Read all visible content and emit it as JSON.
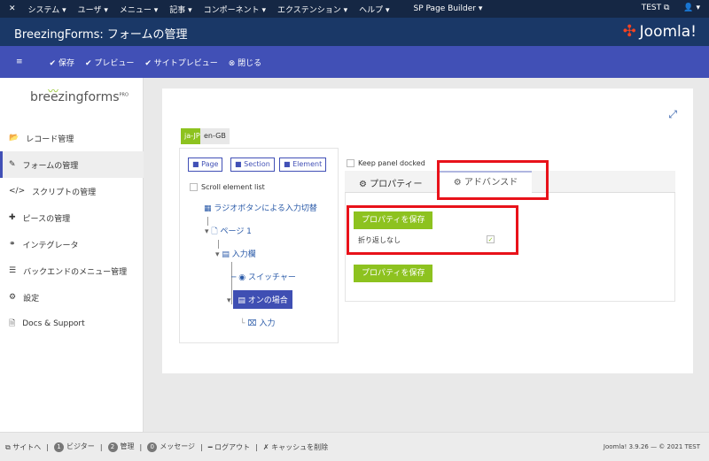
{
  "topnav": {
    "menus": [
      "システム ▾",
      "ユーザ ▾",
      "メニュー ▾",
      "記事 ▾",
      "コンポーネント ▾",
      "エクステンション ▾",
      "ヘルプ ▾",
      "SP Page Builder ▾"
    ],
    "user": "TEST ⧉",
    "account": "👤 ▾"
  },
  "header": {
    "title": "BreezingForms: フォームの管理",
    "logo": "Joomla!"
  },
  "toolbar": {
    "menu": "≡",
    "save": "✔ 保存",
    "preview": "✔ プレビュー",
    "site_preview": "✔ サイトプレビュー",
    "close": "⊗ 閉じる"
  },
  "sidebar": {
    "logo": "breezingforms",
    "logo_pro": "PRO",
    "items": [
      {
        "icon": "📂",
        "label": "レコード管理"
      },
      {
        "icon": "✎",
        "label": "フォームの管理"
      },
      {
        "icon": "</>",
        "label": "スクリプトの管理"
      },
      {
        "icon": "✚",
        "label": "ピースの管理"
      },
      {
        "icon": "⚭",
        "label": "インテグレータ"
      },
      {
        "icon": "☰",
        "label": "バックエンドのメニュー管理"
      },
      {
        "icon": "⚙",
        "label": "設定"
      },
      {
        "icon": "🗎",
        "label": "Docs & Support"
      }
    ]
  },
  "main": {
    "expand": "⤢",
    "langs": [
      "ja-JP",
      "en-GB"
    ],
    "tree": {
      "buttons": [
        "Page",
        "Section",
        "Element"
      ],
      "scroll": "Scroll element list",
      "nodes": [
        "ラジオボタンによる入力切替",
        "ページ 1",
        "入力欄",
        "スイッチャー",
        "オンの場合",
        "入力"
      ]
    },
    "panel": {
      "docked": "Keep panel docked",
      "tabs": [
        "⚙ プロパティー",
        "⚙ アドバンスド"
      ],
      "save": "プロパティを保存",
      "nowrap": "折り返しなし",
      "save2": "プロパティを保存"
    }
  },
  "footer": {
    "site": "⧉ サイトへ",
    "visitors_count": "1",
    "visitors": "ビジター",
    "admins_count": "2",
    "admins": "管理",
    "messages_count": "0",
    "messages": "メッセージ",
    "logout": "━ ログアウト",
    "cache": "✗ キャッシュを削除",
    "version": "Joomla! 3.9.26 — © 2021 TEST"
  }
}
